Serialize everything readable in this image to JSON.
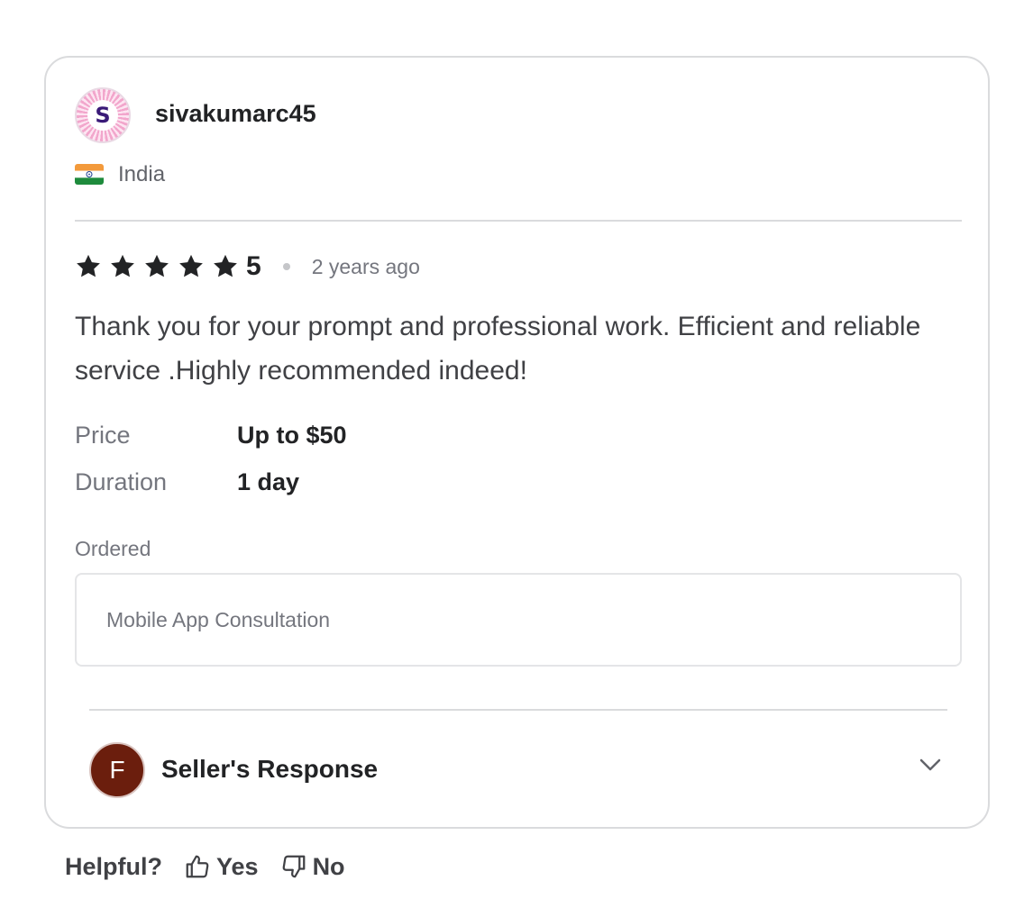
{
  "review": {
    "avatar_letter": "S",
    "username": "sivakumarc45",
    "country": "India",
    "rating": "5",
    "time_ago": "2 years ago",
    "text": "Thank you for your prompt and professional work. Efficient and reliable service .Highly recommended indeed!",
    "price_label": "Price",
    "price_value": "Up to $50",
    "duration_label": "Duration",
    "duration_value": "1 day",
    "ordered_label": "Ordered",
    "ordered_item": "Mobile App Consultation"
  },
  "seller": {
    "avatar_letter": "F",
    "response_label": "Seller's Response"
  },
  "helpful": {
    "label": "Helpful?",
    "yes_label": "Yes",
    "no_label": "No"
  },
  "colors": {
    "text_primary": "#222325",
    "text_secondary": "#74767e",
    "border": "#dadbdd",
    "seller_avatar": "#6b1e0d"
  },
  "icons": [
    "star-icon",
    "india-flag-icon",
    "chevron-down-icon",
    "thumbs-up-icon",
    "thumbs-down-icon"
  ]
}
